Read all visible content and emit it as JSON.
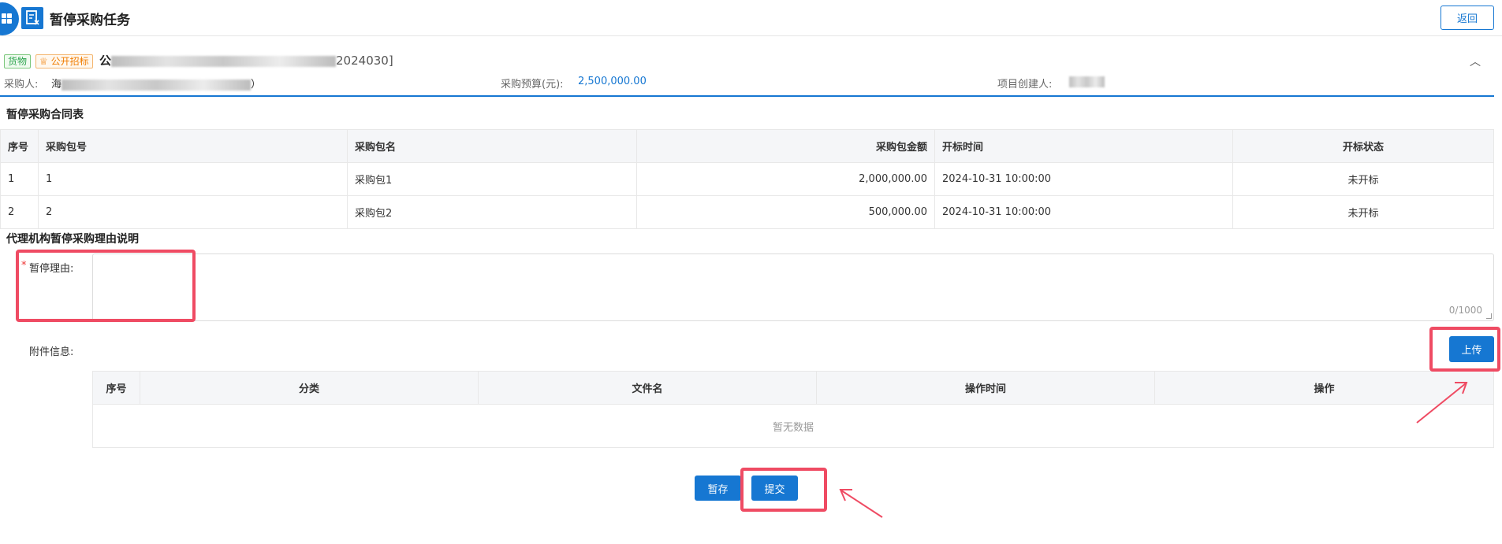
{
  "header": {
    "title": "暂停采购任务",
    "back_label": "返回"
  },
  "project": {
    "tags": [
      "货物",
      "公开招标"
    ],
    "title_prefix": "公",
    "title_suffix": "2024030]",
    "purchaser_label": "采购人:",
    "purchaser_value": "海",
    "purchaser_tail": "）",
    "budget_label": "采购预算(元):",
    "budget_value": "2,500,000.00",
    "creator_label": "项目创建人:"
  },
  "contract_section": {
    "title": "暂停采购合同表",
    "columns": [
      "序号",
      "采购包号",
      "采购包名",
      "采购包金额",
      "开标时间",
      "开标状态"
    ],
    "rows": [
      {
        "index": "1",
        "pkg_no": "1",
        "pkg_name": "采购包1",
        "amount": "2,000,000.00",
        "open_time": "2024-10-31 10:00:00",
        "status": "未开标"
      },
      {
        "index": "2",
        "pkg_no": "2",
        "pkg_name": "采购包2",
        "amount": "500,000.00",
        "open_time": "2024-10-31 10:00:00",
        "status": "未开标"
      }
    ]
  },
  "reason_section": {
    "title": "代理机构暂停采购理由说明",
    "required_mark": "*",
    "reason_label": "暂停理由:",
    "reason_value": "",
    "char_count": "0/1000"
  },
  "attachments": {
    "label": "附件信息:",
    "upload_label": "上传",
    "columns": [
      "序号",
      "分类",
      "文件名",
      "操作时间",
      "操作"
    ],
    "empty_text": "暂无数据"
  },
  "actions": {
    "save_label": "暂存",
    "submit_label": "提交"
  },
  "colors": {
    "primary": "#1677d2",
    "annotation": "#ef4b63"
  }
}
